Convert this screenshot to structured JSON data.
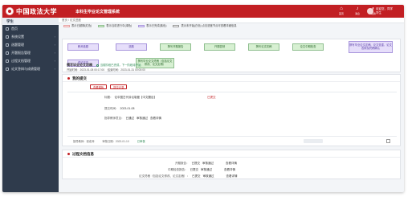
{
  "header": {
    "brand": "中国政法大学",
    "system": "本科生毕业论文管理系统",
    "icons": [
      {
        "icon": "home-icon",
        "label": "首页"
      },
      {
        "icon": "bell-icon",
        "label": "消息"
      },
      {
        "icon": "theme-icon",
        "label": "切换"
      }
    ],
    "user_line1": "欢迎您，同学",
    "user_line2": "学生"
  },
  "sidebar": {
    "role": "学生",
    "items": [
      {
        "icon": "home-icon",
        "label": "首页"
      },
      {
        "icon": "gear-icon",
        "label": "系统设置"
      },
      {
        "icon": "topic-icon",
        "label": "选题管理"
      },
      {
        "icon": "report-icon",
        "label": "开题报告管理"
      },
      {
        "icon": "process-icon",
        "label": "过程文档管理"
      },
      {
        "icon": "defense-icon",
        "label": "论文答辩与成绩管理"
      }
    ]
  },
  "breadcrumb": "首页 / 论文进度",
  "legend": [
    {
      "color": "#fde7e7",
      "label": "表示已超期(红色)"
    },
    {
      "color": "#d7f0d2",
      "label": "表示当前进行中(绿色)"
    },
    {
      "color": "#e6defa",
      "label": "表示已完成(紫色)"
    },
    {
      "color": "#ffffff",
      "label": "表示未开始(白色)  点击进度节点可查看详细信息"
    }
  ],
  "flow": {
    "nodes": [
      "教师选题",
      "选题",
      "撰写开题报告",
      "开题答辩",
      "撰写论文初稿",
      "论文中期检查",
      "撰写毕业论文定稿、论文查重、论文答辩及终稿确认",
      "成绩评定",
      "撰写毕业论文终稿（包括论文修改、论文定稿）"
    ]
  },
  "flow_title": "撰写毕业论文初稿",
  "flow_status": "当前阶段已完成，下一阶段待开始",
  "dates": {
    "start_label": "开始时间：",
    "start": "2023-01-08 00:17:00",
    "end_label": "结束时间：",
    "end": "2023-01-31 00:00:00"
  },
  "card1": {
    "title": "我的提交",
    "buttons": [
      "查看模板",
      "提交记录"
    ],
    "rows": [
      {
        "label": "标题：",
        "value": "论中国古代诉讼制度【中文题目】"
      },
      {
        "label": "提交状态：",
        "value": "已提交"
      },
      {
        "label": "提交时间：",
        "value": "2023-01-08"
      },
      {
        "label": "指导教师意见：",
        "value": "已通过"
      },
      {
        "label": "审核状态：",
        "value": "审核通过"
      },
      {
        "label": "查看详情",
        "value": ""
      }
    ],
    "footer": [
      "指导教师：张老师",
      "审核日期：2023-01-10",
      "已审核"
    ]
  },
  "card2": {
    "title": "过程文档信息",
    "rows": [
      {
        "label": "开题报告：",
        "status": "已提交",
        "audit": "审核通过",
        "link": "查看详情"
      },
      {
        "label": "中期检查报告：",
        "status": "已提交",
        "audit": "审核通过",
        "link": "查看详情"
      },
      {
        "label": "论文终稿（包括论文修改、论文定稿）：",
        "status": "已提交",
        "audit": "审核通过",
        "link": "查看详情"
      }
    ]
  }
}
